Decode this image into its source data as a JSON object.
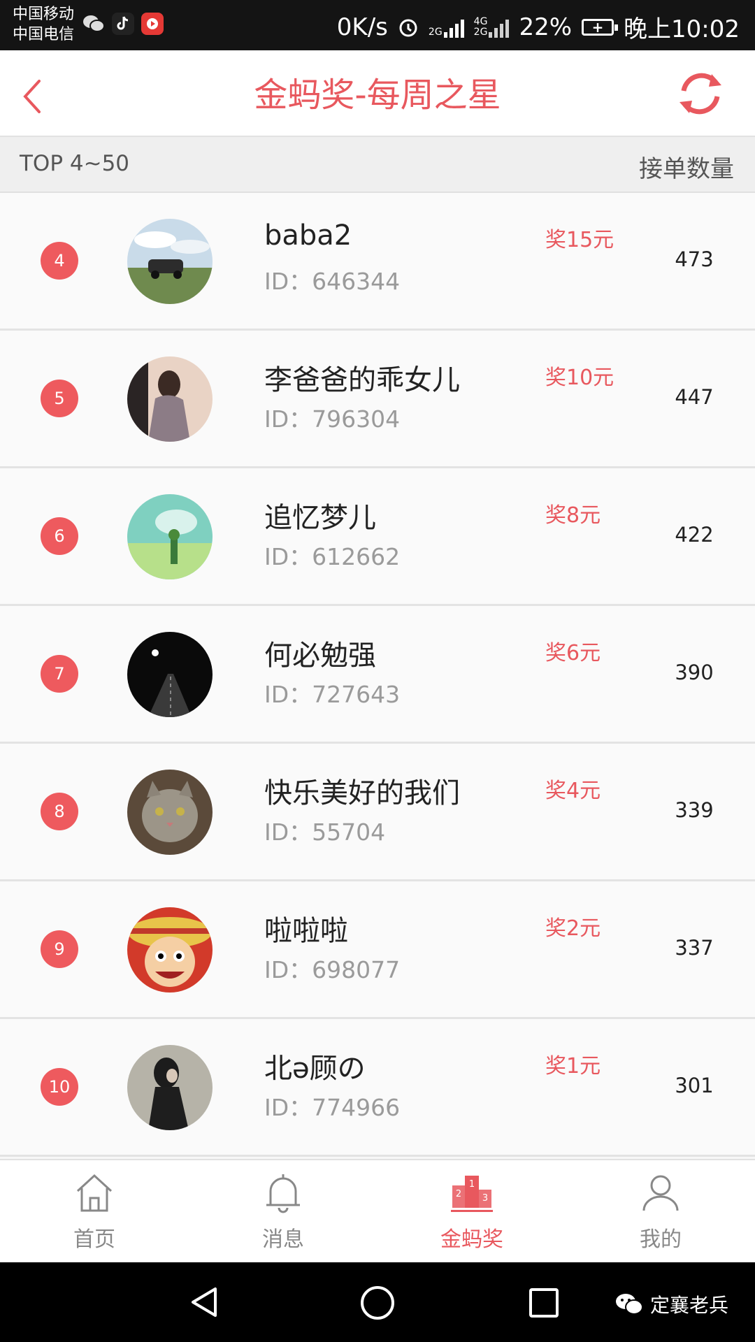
{
  "status_bar": {
    "carrier_1": "中国移动",
    "carrier_2": "中国电信",
    "net_speed": "0K/s",
    "net_badge_1": "2G",
    "net_badge_2_top": "4G",
    "net_badge_2_bottom": "2G",
    "battery_percent": "22%",
    "time": "晚上10:02",
    "icons": [
      "wechat-icon",
      "tiktok-icon",
      "video-app-icon",
      "alarm-icon",
      "signal-icon",
      "battery-charging-icon"
    ]
  },
  "header": {
    "title": "金蚂奖-每周之星",
    "back_icon": "chevron-left-icon",
    "refresh_icon": "refresh-icon",
    "accent": "#e8585e"
  },
  "subheader": {
    "left": "TOP 4~50",
    "right": "接单数量"
  },
  "rows": [
    {
      "rank": "4",
      "name": "baba2",
      "id": "ID：646344",
      "reward": "奖15元",
      "count": "473"
    },
    {
      "rank": "5",
      "name": "李爸爸的乖女儿",
      "id": "ID：796304",
      "reward": "奖10元",
      "count": "447"
    },
    {
      "rank": "6",
      "name": "追忆梦儿",
      "id": "ID：612662",
      "reward": "奖8元",
      "count": "422"
    },
    {
      "rank": "7",
      "name": "何必勉强",
      "id": "ID：727643",
      "reward": "奖6元",
      "count": "390"
    },
    {
      "rank": "8",
      "name": "快乐美好的我们",
      "id": "ID：55704",
      "reward": "奖4元",
      "count": "339"
    },
    {
      "rank": "9",
      "name": "啦啦啦",
      "id": "ID：698077",
      "reward": "奖2元",
      "count": "337"
    },
    {
      "rank": "10",
      "name": "北ə顾の",
      "id": "ID：774966",
      "reward": "奖1元",
      "count": "301"
    }
  ],
  "tabs": [
    {
      "label": "首页",
      "icon": "home-icon",
      "active": false
    },
    {
      "label": "消息",
      "icon": "bell-icon",
      "active": false
    },
    {
      "label": "金蚂奖",
      "icon": "podium-icon",
      "active": true
    },
    {
      "label": "我的",
      "icon": "user-icon",
      "active": false
    }
  ],
  "navbar": {
    "watermark": "定襄老兵"
  }
}
